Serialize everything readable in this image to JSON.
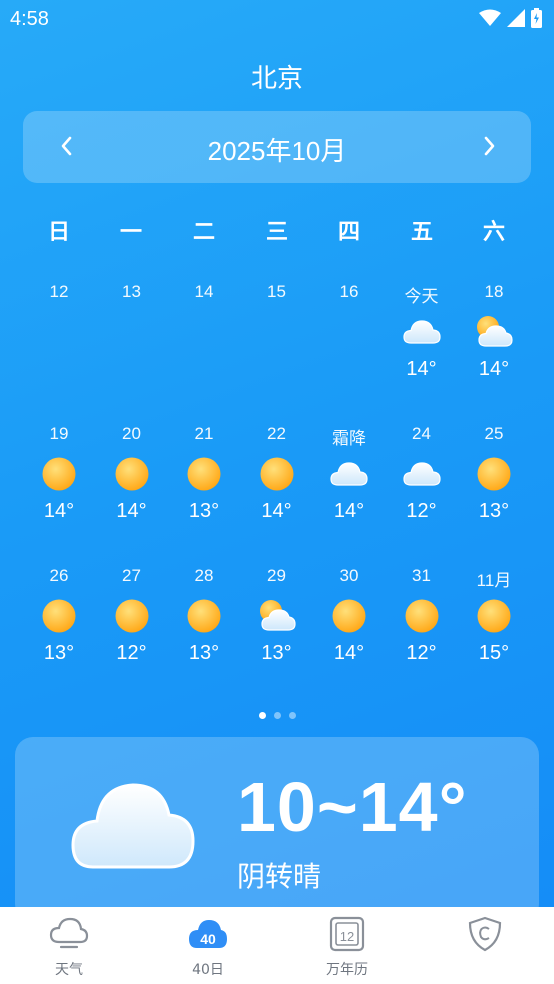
{
  "status": {
    "time": "4:58"
  },
  "city": "北京",
  "month": "2025年10月",
  "weekdays": [
    "日",
    "一",
    "二",
    "三",
    "四",
    "五",
    "六"
  ],
  "weeks": [
    [
      {
        "day": "12",
        "icon": "",
        "temp": ""
      },
      {
        "day": "13",
        "icon": "",
        "temp": ""
      },
      {
        "day": "14",
        "icon": "",
        "temp": ""
      },
      {
        "day": "15",
        "icon": "",
        "temp": ""
      },
      {
        "day": "16",
        "icon": "",
        "temp": ""
      },
      {
        "day": "今天",
        "icon": "cloud-icon",
        "temp": "14°"
      },
      {
        "day": "18",
        "icon": "partly-cloudy-icon",
        "temp": "14°"
      }
    ],
    [
      {
        "day": "19",
        "icon": "sun-icon",
        "temp": "14°"
      },
      {
        "day": "20",
        "icon": "sun-icon",
        "temp": "14°"
      },
      {
        "day": "21",
        "icon": "sun-icon",
        "temp": "13°"
      },
      {
        "day": "22",
        "icon": "sun-icon",
        "temp": "14°"
      },
      {
        "day": "霜降",
        "icon": "cloud-icon",
        "temp": "14°"
      },
      {
        "day": "24",
        "icon": "cloud-icon",
        "temp": "12°"
      },
      {
        "day": "25",
        "icon": "sun-icon",
        "temp": "13°"
      }
    ],
    [
      {
        "day": "26",
        "icon": "sun-icon",
        "temp": "13°"
      },
      {
        "day": "27",
        "icon": "sun-icon",
        "temp": "12°"
      },
      {
        "day": "28",
        "icon": "sun-icon",
        "temp": "13°"
      },
      {
        "day": "29",
        "icon": "partly-cloudy-icon",
        "temp": "13°"
      },
      {
        "day": "30",
        "icon": "sun-icon",
        "temp": "14°"
      },
      {
        "day": "31",
        "icon": "sun-icon",
        "temp": "12°"
      },
      {
        "day": "11月",
        "icon": "sun-icon",
        "temp": "15°"
      }
    ]
  ],
  "pager": {
    "count": 3,
    "active": 0
  },
  "today": {
    "range": "10~14°",
    "condition": "阴转晴",
    "icon": "cloud-icon"
  },
  "tabs": [
    {
      "label": "天气",
      "icon": "cloud-outline-icon"
    },
    {
      "label": "40日",
      "icon": "40-day-icon",
      "badge": "40"
    },
    {
      "label": "万年历",
      "icon": "calendar-icon",
      "badge": "12"
    },
    {
      "label": "",
      "icon": "shield-icon"
    }
  ],
  "colors": {
    "accent": "#1a9bf7",
    "sun": "#ffb31a",
    "tab_active": "#2f8ef6",
    "tab_inactive": "#6f7680"
  }
}
